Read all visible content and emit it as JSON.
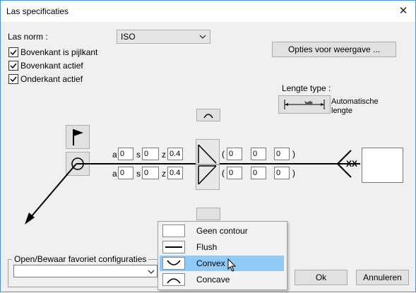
{
  "window": {
    "title": "Las specificaties"
  },
  "form": {
    "las_norm_label": "Las norm :",
    "las_norm_value": "ISO",
    "checkboxes": [
      {
        "label": "Bovenkant is pijlkant",
        "checked": true
      },
      {
        "label": "Bovenkant actief",
        "checked": true
      },
      {
        "label": "Onderkant actief",
        "checked": true
      }
    ],
    "options_button": "Opties voor weergave ..."
  },
  "length": {
    "label": "Lengte type :",
    "value_line1": "Automatische",
    "value_line2": "lengte"
  },
  "top_row": {
    "a_label": "a",
    "a_value": "0",
    "s_label": "s",
    "s_value": "0",
    "z_label": "z",
    "z_value": "0.4",
    "open_paren": "(",
    "close_paren": ")",
    "f1": "0",
    "f2": "0",
    "f3": "0"
  },
  "bottom_row": {
    "a_label": "a",
    "a_value": "0",
    "s_label": "s",
    "s_value": "0",
    "z_label": "z",
    "z_value": "0.4",
    "open_paren": "(",
    "close_paren": ")",
    "f1": "0",
    "f2": "0",
    "f3": "0"
  },
  "tail": {
    "text": "XX"
  },
  "favorites": {
    "label": "Open/Bewaar favoriet configuraties",
    "value": ""
  },
  "buttons": {
    "ok": "Ok",
    "cancel": "Annuleren"
  },
  "contour_menu": {
    "items": [
      {
        "label": "Geen contour",
        "icon": "no-contour-icon",
        "selected": false
      },
      {
        "label": "Flush",
        "icon": "flush-icon",
        "selected": false
      },
      {
        "label": "Convex",
        "icon": "convex-icon",
        "selected": true
      },
      {
        "label": "Concave",
        "icon": "concave-icon",
        "selected": false
      }
    ]
  },
  "colors": {
    "accent": "#0078d7",
    "selection": "#91c9f7",
    "dialog_bg": "#f0f0f0"
  }
}
